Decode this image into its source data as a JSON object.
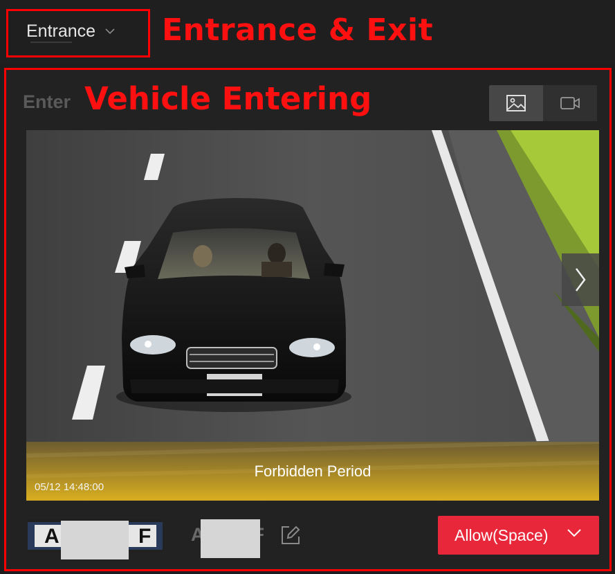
{
  "header": {
    "selector_value": "Entrance",
    "annotation": "Entrance & Exit"
  },
  "panel": {
    "label": "Enter",
    "annotation": "Vehicle Entering",
    "view_modes": [
      "picture-icon",
      "video-icon"
    ],
    "active_mode": "picture-icon"
  },
  "capture": {
    "status_text": "Forbidden Period",
    "timestamp": "05/12 14:48:00"
  },
  "plate": {
    "text_prefix": "A",
    "text_suffix": "F",
    "image_chars": {
      "first": "A",
      "last": "F"
    }
  },
  "action": {
    "allow_label": "Allow(Space)"
  },
  "colors": {
    "annotation_red": "#ff0000",
    "allow_button": "#e8283a",
    "overlay_gold": "#e1b41e",
    "background": "#1e1e1e"
  }
}
